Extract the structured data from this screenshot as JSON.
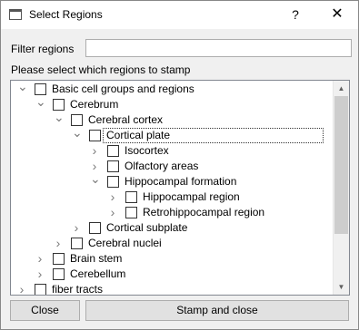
{
  "window": {
    "title": "Select Regions",
    "help": "?",
    "close": "✕"
  },
  "filter": {
    "label": "Filter regions",
    "value": "",
    "placeholder": ""
  },
  "instruction": "Please select which regions to stamp",
  "tree": {
    "items": [
      {
        "label": "Basic cell groups and regions",
        "expanded": true,
        "checked": false
      },
      {
        "label": "Cerebrum",
        "expanded": true,
        "checked": false
      },
      {
        "label": "Cerebral cortex",
        "expanded": true,
        "checked": false
      },
      {
        "label": "Cortical plate",
        "expanded": true,
        "checked": false,
        "focused": true
      },
      {
        "label": "Isocortex",
        "expanded": false,
        "checked": false
      },
      {
        "label": "Olfactory areas",
        "expanded": false,
        "checked": false
      },
      {
        "label": "Hippocampal formation",
        "expanded": true,
        "checked": false
      },
      {
        "label": "Hippocampal region",
        "expanded": false,
        "checked": false
      },
      {
        "label": "Retrohippocampal region",
        "expanded": false,
        "checked": false
      },
      {
        "label": "Cortical subplate",
        "expanded": false,
        "checked": false
      },
      {
        "label": "Cerebral nuclei",
        "expanded": false,
        "checked": false
      },
      {
        "label": "Brain stem",
        "expanded": false,
        "checked": false
      },
      {
        "label": "Cerebellum",
        "expanded": false,
        "checked": false
      },
      {
        "label": "fiber tracts",
        "expanded": false,
        "checked": false
      }
    ]
  },
  "buttons": {
    "close": "Close",
    "stamp": "Stamp and close"
  },
  "icons": {
    "expanded": "chevron-down-icon",
    "collapsed": "chevron-right-icon",
    "scroll_up": "arrow-up-icon",
    "scroll_down": "arrow-down-icon"
  }
}
